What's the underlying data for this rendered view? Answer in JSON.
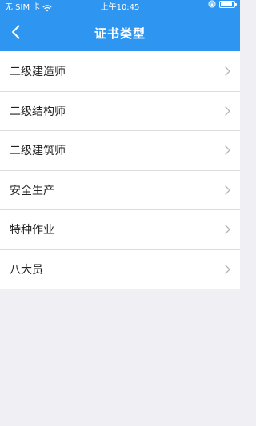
{
  "status_bar": {
    "carrier": "无 SIM 卡",
    "time": "上午10:45",
    "battery_level": 0.85
  },
  "nav": {
    "title": "证书类型",
    "back_icon": "chevron-left-icon"
  },
  "colors": {
    "nav_background": "#2e96f0",
    "page_background": "#efeff4"
  },
  "list": {
    "items": [
      {
        "label": "二级建造师"
      },
      {
        "label": "二级结构师"
      },
      {
        "label": "二级建筑师"
      },
      {
        "label": "安全生产"
      },
      {
        "label": "特种作业"
      },
      {
        "label": "八大员"
      }
    ]
  }
}
